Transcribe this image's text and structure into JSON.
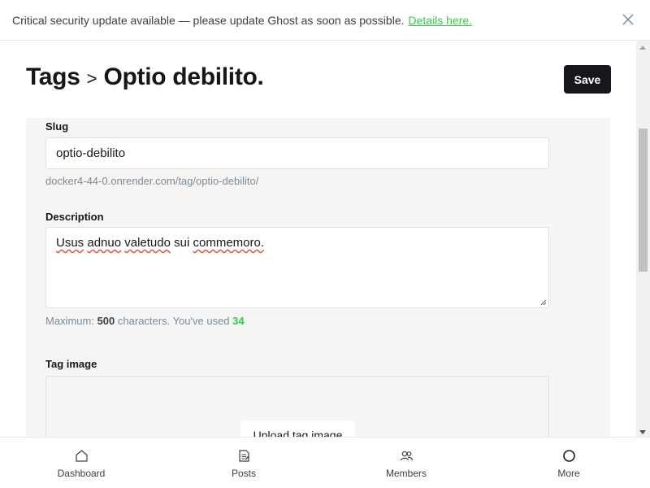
{
  "alert": {
    "message": "Critical security update available — please update Ghost as soon as possible.",
    "link": "Details here."
  },
  "header": {
    "breadcrumb": "Tags",
    "separator": ">",
    "title": "Optio debilito.",
    "save_label": "Save"
  },
  "form": {
    "slug_label": "Slug",
    "slug_value": "optio-debilito",
    "url_hint": "docker4-44-0.onrender.com/tag/optio-debilito/",
    "description_label": "Description",
    "description_words": [
      "Usus",
      "adnuo",
      "valetudo",
      "sui",
      "commemoro."
    ],
    "counter_prefix": "Maximum:",
    "counter_max": "500",
    "counter_middle": "characters. You've used",
    "counter_used": "34",
    "tag_image_label": "Tag image",
    "upload_label": "Upload tag image"
  },
  "nav": {
    "items": [
      {
        "label": "Dashboard",
        "icon": "home-icon"
      },
      {
        "label": "Posts",
        "icon": "posts-icon"
      },
      {
        "label": "Members",
        "icon": "members-icon"
      },
      {
        "label": "More",
        "icon": "more-icon"
      }
    ]
  },
  "colors": {
    "accent_green": "#30cf43",
    "dark": "#15171a",
    "panel_bg": "#f4f5f4",
    "muted": "#7c8b9a"
  }
}
